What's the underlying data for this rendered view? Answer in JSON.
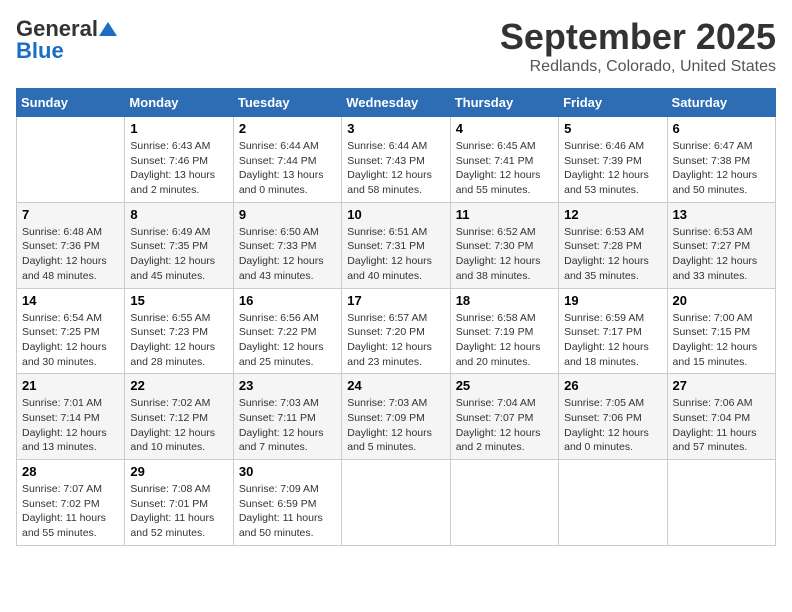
{
  "header": {
    "logo_general": "General",
    "logo_blue": "Blue",
    "month_title": "September 2025",
    "location": "Redlands, Colorado, United States"
  },
  "days_of_week": [
    "Sunday",
    "Monday",
    "Tuesday",
    "Wednesday",
    "Thursday",
    "Friday",
    "Saturday"
  ],
  "weeks": [
    [
      {
        "day": "",
        "info": ""
      },
      {
        "day": "1",
        "info": "Sunrise: 6:43 AM\nSunset: 7:46 PM\nDaylight: 13 hours\nand 2 minutes."
      },
      {
        "day": "2",
        "info": "Sunrise: 6:44 AM\nSunset: 7:44 PM\nDaylight: 13 hours\nand 0 minutes."
      },
      {
        "day": "3",
        "info": "Sunrise: 6:44 AM\nSunset: 7:43 PM\nDaylight: 12 hours\nand 58 minutes."
      },
      {
        "day": "4",
        "info": "Sunrise: 6:45 AM\nSunset: 7:41 PM\nDaylight: 12 hours\nand 55 minutes."
      },
      {
        "day": "5",
        "info": "Sunrise: 6:46 AM\nSunset: 7:39 PM\nDaylight: 12 hours\nand 53 minutes."
      },
      {
        "day": "6",
        "info": "Sunrise: 6:47 AM\nSunset: 7:38 PM\nDaylight: 12 hours\nand 50 minutes."
      }
    ],
    [
      {
        "day": "7",
        "info": "Sunrise: 6:48 AM\nSunset: 7:36 PM\nDaylight: 12 hours\nand 48 minutes."
      },
      {
        "day": "8",
        "info": "Sunrise: 6:49 AM\nSunset: 7:35 PM\nDaylight: 12 hours\nand 45 minutes."
      },
      {
        "day": "9",
        "info": "Sunrise: 6:50 AM\nSunset: 7:33 PM\nDaylight: 12 hours\nand 43 minutes."
      },
      {
        "day": "10",
        "info": "Sunrise: 6:51 AM\nSunset: 7:31 PM\nDaylight: 12 hours\nand 40 minutes."
      },
      {
        "day": "11",
        "info": "Sunrise: 6:52 AM\nSunset: 7:30 PM\nDaylight: 12 hours\nand 38 minutes."
      },
      {
        "day": "12",
        "info": "Sunrise: 6:53 AM\nSunset: 7:28 PM\nDaylight: 12 hours\nand 35 minutes."
      },
      {
        "day": "13",
        "info": "Sunrise: 6:53 AM\nSunset: 7:27 PM\nDaylight: 12 hours\nand 33 minutes."
      }
    ],
    [
      {
        "day": "14",
        "info": "Sunrise: 6:54 AM\nSunset: 7:25 PM\nDaylight: 12 hours\nand 30 minutes."
      },
      {
        "day": "15",
        "info": "Sunrise: 6:55 AM\nSunset: 7:23 PM\nDaylight: 12 hours\nand 28 minutes."
      },
      {
        "day": "16",
        "info": "Sunrise: 6:56 AM\nSunset: 7:22 PM\nDaylight: 12 hours\nand 25 minutes."
      },
      {
        "day": "17",
        "info": "Sunrise: 6:57 AM\nSunset: 7:20 PM\nDaylight: 12 hours\nand 23 minutes."
      },
      {
        "day": "18",
        "info": "Sunrise: 6:58 AM\nSunset: 7:19 PM\nDaylight: 12 hours\nand 20 minutes."
      },
      {
        "day": "19",
        "info": "Sunrise: 6:59 AM\nSunset: 7:17 PM\nDaylight: 12 hours\nand 18 minutes."
      },
      {
        "day": "20",
        "info": "Sunrise: 7:00 AM\nSunset: 7:15 PM\nDaylight: 12 hours\nand 15 minutes."
      }
    ],
    [
      {
        "day": "21",
        "info": "Sunrise: 7:01 AM\nSunset: 7:14 PM\nDaylight: 12 hours\nand 13 minutes."
      },
      {
        "day": "22",
        "info": "Sunrise: 7:02 AM\nSunset: 7:12 PM\nDaylight: 12 hours\nand 10 minutes."
      },
      {
        "day": "23",
        "info": "Sunrise: 7:03 AM\nSunset: 7:11 PM\nDaylight: 12 hours\nand 7 minutes."
      },
      {
        "day": "24",
        "info": "Sunrise: 7:03 AM\nSunset: 7:09 PM\nDaylight: 12 hours\nand 5 minutes."
      },
      {
        "day": "25",
        "info": "Sunrise: 7:04 AM\nSunset: 7:07 PM\nDaylight: 12 hours\nand 2 minutes."
      },
      {
        "day": "26",
        "info": "Sunrise: 7:05 AM\nSunset: 7:06 PM\nDaylight: 12 hours\nand 0 minutes."
      },
      {
        "day": "27",
        "info": "Sunrise: 7:06 AM\nSunset: 7:04 PM\nDaylight: 11 hours\nand 57 minutes."
      }
    ],
    [
      {
        "day": "28",
        "info": "Sunrise: 7:07 AM\nSunset: 7:02 PM\nDaylight: 11 hours\nand 55 minutes."
      },
      {
        "day": "29",
        "info": "Sunrise: 7:08 AM\nSunset: 7:01 PM\nDaylight: 11 hours\nand 52 minutes."
      },
      {
        "day": "30",
        "info": "Sunrise: 7:09 AM\nSunset: 6:59 PM\nDaylight: 11 hours\nand 50 minutes."
      },
      {
        "day": "",
        "info": ""
      },
      {
        "day": "",
        "info": ""
      },
      {
        "day": "",
        "info": ""
      },
      {
        "day": "",
        "info": ""
      }
    ]
  ]
}
